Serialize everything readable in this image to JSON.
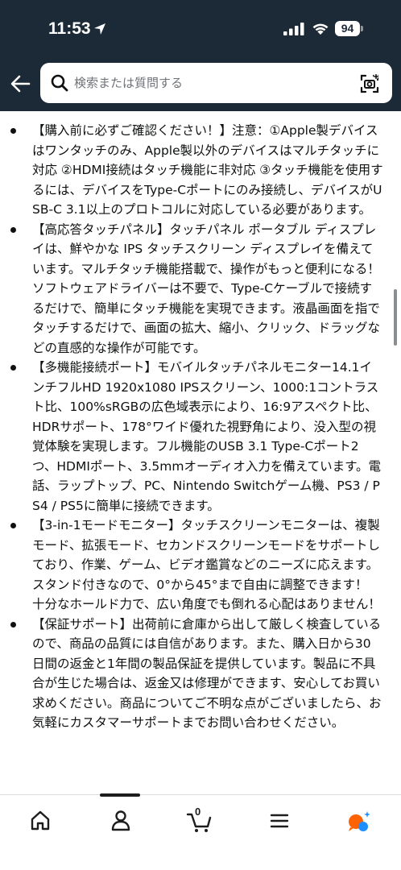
{
  "status_bar": {
    "time": "11:53",
    "battery": "94"
  },
  "header": {
    "back_icon": "back-arrow-icon",
    "search_placeholder": "検索または質問する",
    "camera_icon": "camera-search-icon",
    "background": "#1c2a37"
  },
  "bullets": [
    {
      "text": "【購入前に必ずご確認ください！】注意：①Apple製デバイスはワンタッチのみ、Apple製以外のデバイスはマルチタッチに対応 ②HDMI接続はタッチ機能に非対応 ③タッチ機能を使用するには、デバイスをType-Cポートにのみ接続し、デバイスがUSB-C 3.1以上のプロトコルに対応している必要があります。"
    },
    {
      "text": "【高応答タッチパネル】タッチパネル ポータブル ディスプレイは、鮮やかな IPS タッチスクリーン ディスプレイを備えています。マルチタッチ機能搭載で、操作がもっと便利になる！ソフトウェアドライバーは不要で、Type-Cケーブルで接続するだけで、簡単にタッチ機能を実現できます。液晶画面を指でタッチするだけで、画面の拡大、縮小、クリック、ドラッグなどの直感的な操作が可能です。"
    },
    {
      "text": "【多機能接続ポート】モバイルタッチパネルモニター14.1インチフルHD 1920x1080 IPSスクリーン、1000:1コントラスト比、100%sRGBの広色域表示により、16:9アスペクト比、HDRサポート、178°ワイド優れた視野角により、没入型の視覚体験を実現します。フル機能のUSB 3.1 Type-Cポート2つ、HDMIポート、3.5mmオーディオ入力を備えています。電話、ラップトップ、PC、Nintendo Switchゲーム機、PS3 / PS4 / PS5に簡単に接続できます。"
    },
    {
      "text": "【3-in-1モードモニター】タッチスクリーンモニターは、複製モード、拡張モード、セカンドスクリーンモードをサポートしており、作業、ゲーム、ビデオ鑑賞などのニーズに応えます。 スタンド付きなので、0°から45°まで自由に調整できます！ 十分なホールド力で、広い角度でも倒れる心配はありません！"
    },
    {
      "text": "【保証サポート】出荷前に倉庫から出して厳しく検査しているので、商品の品質には自信があります。また、購入日から30日間の返金と1年間の製品保証を提供しています。製品に不具合が生じた場合は、返金又は修理ができます、安心してお買い求めください。商品についてご不明な点がございましたら、お気軽にカスタマーサポートまでお問い合わせください。"
    }
  ],
  "tab_bar": {
    "tabs": [
      {
        "name": "home",
        "icon": "home-icon"
      },
      {
        "name": "account",
        "icon": "person-icon"
      },
      {
        "name": "cart",
        "icon": "cart-icon",
        "count": "0"
      },
      {
        "name": "menu",
        "icon": "hamburger-menu-icon"
      },
      {
        "name": "rufus",
        "icon": "chat-assistant-icon"
      }
    ],
    "accent_colors": [
      "#ff6200",
      "#1f8fff"
    ]
  }
}
